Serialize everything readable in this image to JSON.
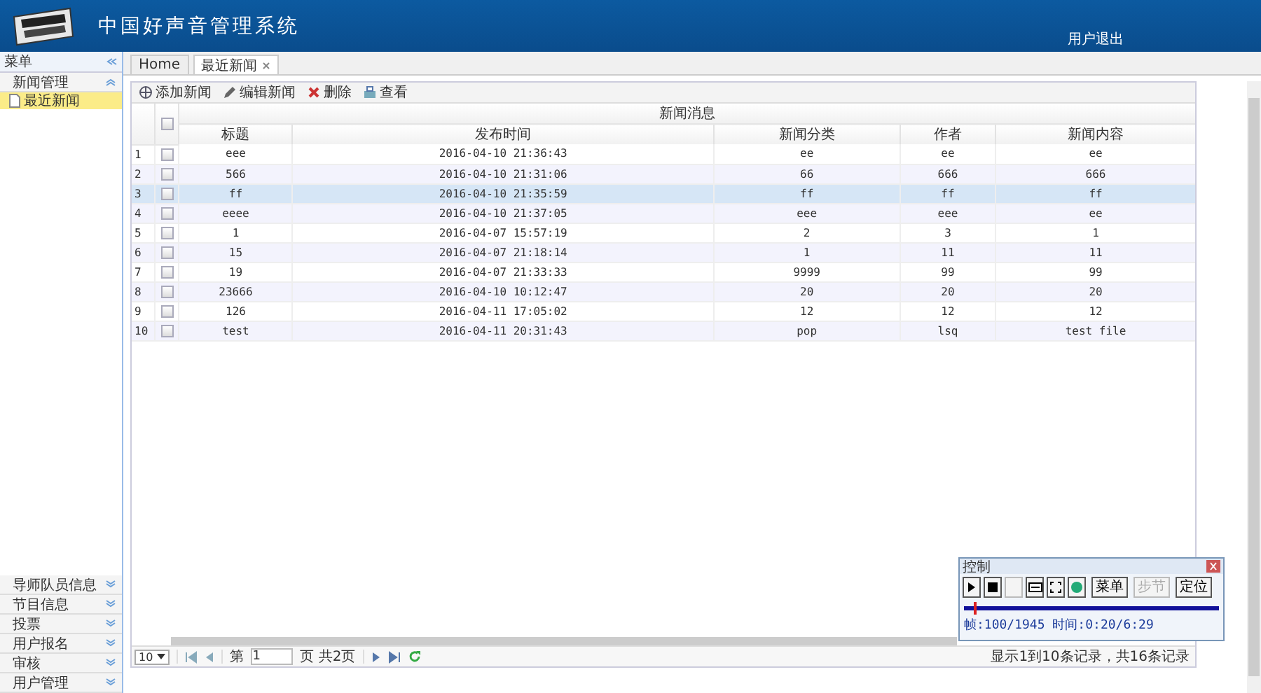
{
  "header": {
    "title": "中国好声音管理系统",
    "logout": "用户退出"
  },
  "sidebar": {
    "title": "菜单",
    "groups": [
      {
        "label": "新闻管理",
        "expanded": true,
        "children": [
          {
            "label": "最近新闻",
            "selected": true
          }
        ]
      }
    ],
    "bottom_groups": [
      {
        "label": "导师队员信息",
        "expanded": false
      },
      {
        "label": "节目信息",
        "expanded": false
      },
      {
        "label": "投票",
        "expanded": false
      },
      {
        "label": "用户报名",
        "expanded": false
      },
      {
        "label": "审核",
        "expanded": false
      },
      {
        "label": "用户管理",
        "expanded": false
      }
    ]
  },
  "tabs": [
    {
      "label": "Home",
      "selected": false,
      "closable": false
    },
    {
      "label": "最近新闻",
      "selected": true,
      "closable": true
    }
  ],
  "toolbar": [
    {
      "kind": "add",
      "label": "添加新闻"
    },
    {
      "kind": "edit",
      "label": "编辑新闻"
    },
    {
      "kind": "delete",
      "label": "删除"
    },
    {
      "kind": "view",
      "label": "查看"
    }
  ],
  "table": {
    "group_title": "新闻消息",
    "all_checked": false,
    "columns": [
      "标题",
      "发布时间",
      "新闻分类",
      "作者",
      "新闻内容"
    ],
    "rows": [
      {
        "n": "1",
        "checked": false,
        "selected": false,
        "cells": [
          "eee",
          "2016-04-10 21:36:43",
          "ee",
          "ee",
          "ee"
        ]
      },
      {
        "n": "2",
        "checked": false,
        "selected": false,
        "cells": [
          "566",
          "2016-04-10 21:31:06",
          "66",
          "666",
          "666"
        ]
      },
      {
        "n": "3",
        "checked": false,
        "selected": true,
        "cells": [
          "ff",
          "2016-04-10 21:35:59",
          "ff",
          "ff",
          "ff"
        ]
      },
      {
        "n": "4",
        "checked": false,
        "selected": false,
        "cells": [
          "eeee",
          "2016-04-10 21:37:05",
          "eee",
          "eee",
          "ee"
        ]
      },
      {
        "n": "5",
        "checked": false,
        "selected": false,
        "cells": [
          "1",
          "2016-04-07 15:57:19",
          "2",
          "3",
          "1"
        ]
      },
      {
        "n": "6",
        "checked": false,
        "selected": false,
        "cells": [
          "15",
          "2016-04-07 21:18:14",
          "1",
          "11",
          "11"
        ]
      },
      {
        "n": "7",
        "checked": false,
        "selected": false,
        "cells": [
          "19",
          "2016-04-07 21:33:33",
          "9999",
          "99",
          "99"
        ]
      },
      {
        "n": "8",
        "checked": false,
        "selected": false,
        "cells": [
          "23666",
          "2016-04-10 10:12:47",
          "20",
          "20",
          "20"
        ]
      },
      {
        "n": "9",
        "checked": false,
        "selected": false,
        "cells": [
          "126",
          "2016-04-11 17:05:02",
          "12",
          "12",
          "12"
        ]
      },
      {
        "n": "10",
        "checked": false,
        "selected": false,
        "cells": [
          "test",
          "2016-04-11 20:31:43",
          "pop",
          "lsq",
          "test file"
        ]
      }
    ]
  },
  "pager": {
    "page_size": "10",
    "before": "第",
    "page": "1",
    "after": "页 共2页",
    "summary": "显示1到10条记录，共16条记录"
  },
  "recorder": {
    "title": "控制",
    "buttons": [
      {
        "kind": "play",
        "disabled": false
      },
      {
        "kind": "stop",
        "disabled": false
      },
      {
        "kind": "blank",
        "disabled": true
      },
      {
        "kind": "screen",
        "disabled": false
      },
      {
        "kind": "frame",
        "disabled": false
      },
      {
        "kind": "cursor",
        "disabled": false
      },
      {
        "kind": "text",
        "label": "菜单",
        "disabled": false
      },
      {
        "kind": "text",
        "label": "步节",
        "disabled": true
      },
      {
        "kind": "text",
        "label": "定位",
        "disabled": false
      }
    ],
    "level": 0.05,
    "status": "帧:100/1945 时间:0:20/6:29"
  }
}
